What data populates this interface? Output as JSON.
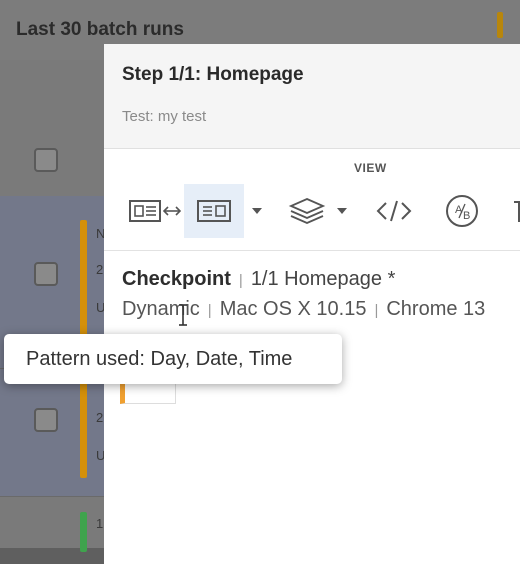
{
  "background": {
    "title": "Last 30 batch runs",
    "rows": [
      {
        "line1": "N",
        "line2": "2",
        "line3": "U"
      },
      {
        "line1": "",
        "line2": "2",
        "line3": "U"
      },
      {
        "line1": "1",
        "line2": "",
        "line3": ""
      }
    ]
  },
  "modal": {
    "title": "Step 1/1:  Homepage",
    "subtitle": "Test: my test",
    "view_label": "VIEW",
    "toolbar_icons": [
      "side-by-side-compare-icon",
      "single-view-icon",
      "layers-icon",
      "code-icon",
      "ab-test-icon"
    ],
    "checkpoint": {
      "label": "Checkpoint",
      "value": "1/1 Homepage *"
    },
    "details": {
      "mode": "Dynamic",
      "os": "Mac OS X 10.15",
      "browser": "Chrome 13"
    }
  },
  "tooltip": {
    "text": "Pattern used: Day, Date, Time"
  },
  "colors": {
    "accent_orange": "#f0a030",
    "bar_green": "#3fa34d",
    "active_tab_bg": "#e6eef8"
  }
}
